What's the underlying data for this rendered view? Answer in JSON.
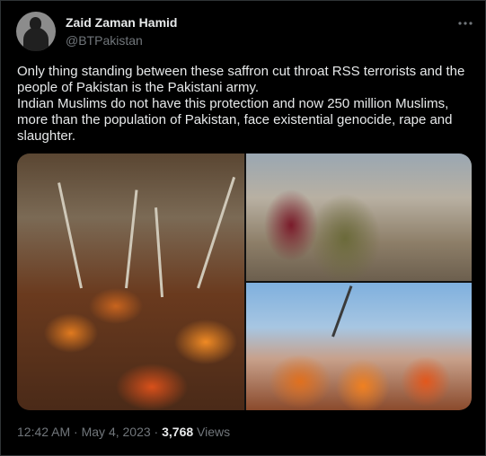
{
  "author": {
    "name": "Zaid Zaman Hamid",
    "handle": "@BTPakistan"
  },
  "more_icon": "more-horizontal-icon",
  "tweet_text": {
    "paragraph1": "Only thing standing between these saffron cut throat RSS terrorists and the people of Pakistan is the Pakistani army.",
    "paragraph2": "Indian Muslims do not have this protection and now 250 million Muslims, more than the population of Pakistan, face existential genocide, rape and slaughter."
  },
  "meta": {
    "time": "12:42 AM",
    "separator1": " · ",
    "date": "May 4, 2023",
    "separator2": " · ",
    "views_count": "3,768",
    "views_label": " Views"
  },
  "colors": {
    "background": "#000000",
    "text": "#e7e9ea",
    "secondary": "#71767b",
    "border": "#2f3336"
  }
}
